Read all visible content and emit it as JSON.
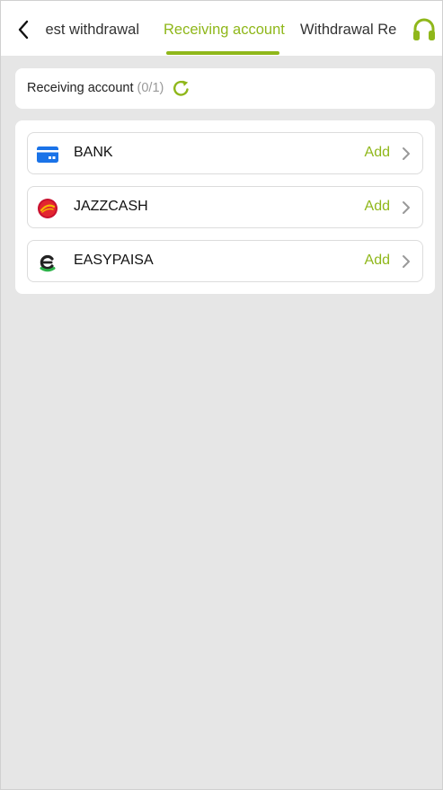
{
  "header": {
    "tabs": [
      {
        "label": "Request withdrawal"
      },
      {
        "label": "Receiving account",
        "active": true
      },
      {
        "label": "Withdrawal Record"
      }
    ],
    "back_icon": "chevron-left-icon",
    "support_icon": "headset-icon"
  },
  "summary": {
    "label": "Receiving account",
    "count": "(0/1)",
    "refresh_icon": "refresh-icon"
  },
  "accounts": [
    {
      "name": "BANK",
      "action": "Add",
      "icon": "bank-card-icon"
    },
    {
      "name": "JAZZCASH",
      "action": "Add",
      "icon": "jazzcash-logo-icon"
    },
    {
      "name": "EASYPAISA",
      "action": "Add",
      "icon": "easypaisa-logo-icon"
    }
  ],
  "colors": {
    "accent": "#8fb71a",
    "background": "#e6e6e6",
    "bank_blue": "#1a73e8",
    "jazz_red": "#c8102e",
    "easypaisa_green": "#2db34a"
  }
}
